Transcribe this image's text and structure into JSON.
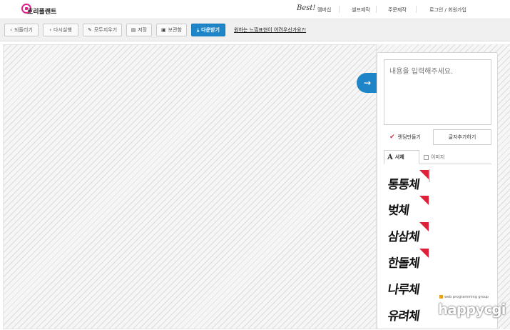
{
  "header": {
    "logo_text": "호리플랜트",
    "nav": {
      "best_label": "Best!",
      "items": [
        "멤버십",
        "셀프제작",
        "주문제작",
        "로그인 / 회원가입"
      ]
    }
  },
  "toolbar": {
    "buttons": [
      {
        "label": "되돌리기",
        "icon": "undo-icon"
      },
      {
        "label": "다시실행",
        "icon": "redo-icon"
      },
      {
        "label": "모두지우기",
        "icon": "erase-icon"
      },
      {
        "label": "저장",
        "icon": "save-icon"
      },
      {
        "label": "보관함",
        "icon": "briefcase-icon"
      },
      {
        "label": "다운받기",
        "icon": "download-icon"
      }
    ],
    "help_link": "원하는 느낌표현이 어려우신가요?!"
  },
  "panel": {
    "textarea_placeholder": "내용을 입력해주세요.",
    "make_button": "랜덤만들기",
    "add_button": "글자추가하기",
    "tabs": [
      {
        "label": "서체",
        "icon": "font-icon",
        "active": true
      },
      {
        "label": "이미지",
        "icon": "image-icon",
        "active": false
      }
    ],
    "fonts": [
      {
        "name": "통통체",
        "badge": true
      },
      {
        "name": "벚체",
        "badge": true
      },
      {
        "name": "삼삼체",
        "badge": true
      },
      {
        "name": "한돌체",
        "badge": true
      },
      {
        "name": "나루체",
        "badge": false
      },
      {
        "name": "유려체",
        "badge": false
      }
    ]
  },
  "watermark": {
    "sub": "web programming group",
    "main": "happycgi"
  },
  "colors": {
    "primary": "#1e86c8",
    "badge": "#e0203a",
    "logo": "#e0218a"
  }
}
